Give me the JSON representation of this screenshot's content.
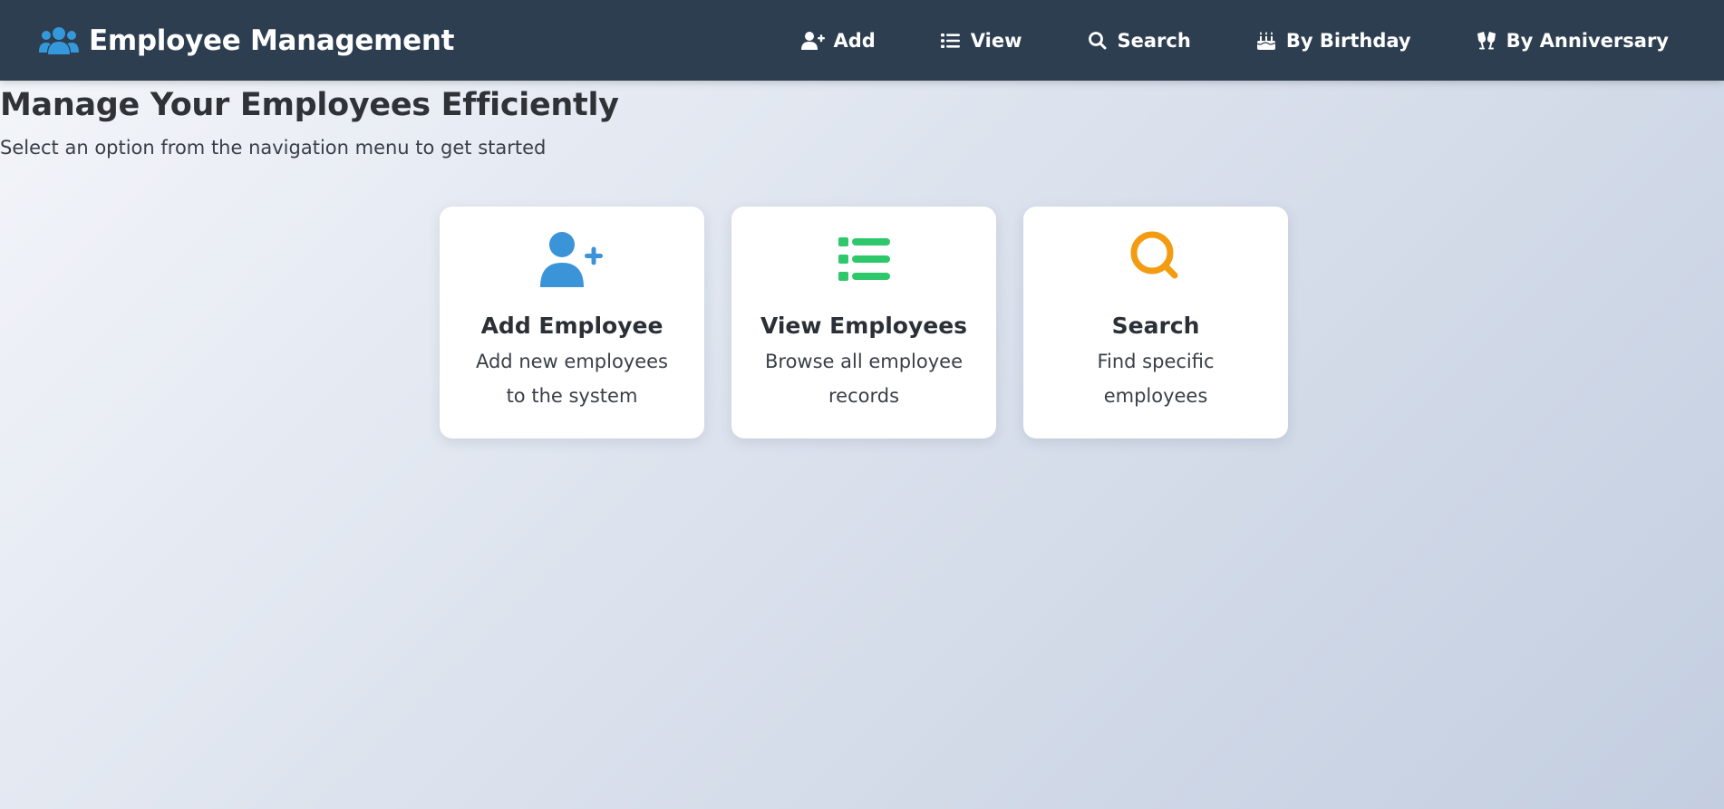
{
  "header": {
    "brand": {
      "title": "Employee Management",
      "icon": "users-icon"
    },
    "nav": [
      {
        "label": "Add",
        "icon": "user-plus-icon"
      },
      {
        "label": "View",
        "icon": "list-icon"
      },
      {
        "label": "Search",
        "icon": "search-icon"
      },
      {
        "label": "By Birthday",
        "icon": "birthday-cake-icon"
      },
      {
        "label": "By Anniversary",
        "icon": "glass-cheers-icon"
      }
    ]
  },
  "main": {
    "title": "Manage Your Employees Efficiently",
    "subtitle": "Select an option from the navigation menu to get started",
    "cards": [
      {
        "title": "Add Employee",
        "description": "Add new employees to the system",
        "icon": "user-plus-icon",
        "color": "#3b93d8"
      },
      {
        "title": "View Employees",
        "description": "Browse all employee records",
        "icon": "list-icon",
        "color": "#2ec86b"
      },
      {
        "title": "Search",
        "description": "Find specific employees",
        "icon": "search-icon",
        "color": "#f39c12"
      }
    ]
  },
  "colors": {
    "header_bg": "#2c3e50",
    "brand_icon": "#3498db",
    "text_dark": "#2b2f36"
  }
}
